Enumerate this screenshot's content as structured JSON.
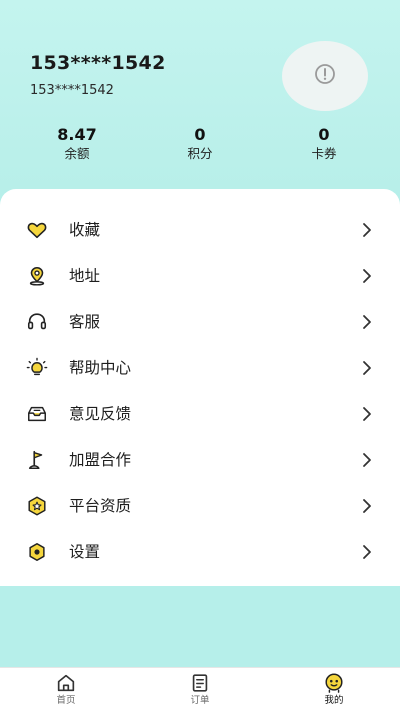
{
  "user": {
    "name": "153****1542",
    "phone": "153****1542",
    "avatar_icon": "alert-circle-icon"
  },
  "stats": [
    {
      "value": "8.47",
      "label": "余额"
    },
    {
      "value": "0",
      "label": "积分"
    },
    {
      "value": "0",
      "label": "卡券"
    }
  ],
  "menu": {
    "items": [
      {
        "label": "收藏",
        "icon": "heart-icon"
      },
      {
        "label": "地址",
        "icon": "location-pin-icon"
      },
      {
        "label": "客服",
        "icon": "headset-icon"
      },
      {
        "label": "帮助中心",
        "icon": "lightbulb-icon"
      },
      {
        "label": "意见反馈",
        "icon": "feedback-inbox-icon"
      },
      {
        "label": "加盟合作",
        "icon": "flag-icon"
      },
      {
        "label": "平台资质",
        "icon": "star-badge-icon"
      },
      {
        "label": "设置",
        "icon": "settings-hex-icon"
      }
    ]
  },
  "tabbar": {
    "tabs": [
      {
        "label": "首页",
        "icon": "home-icon"
      },
      {
        "label": "订单",
        "icon": "order-list-icon"
      },
      {
        "label": "我的",
        "icon": "profile-face-icon",
        "active": true
      }
    ]
  },
  "colors": {
    "background": "#b6efea",
    "accent_yellow": "#f5d63d",
    "card": "#ffffff"
  }
}
